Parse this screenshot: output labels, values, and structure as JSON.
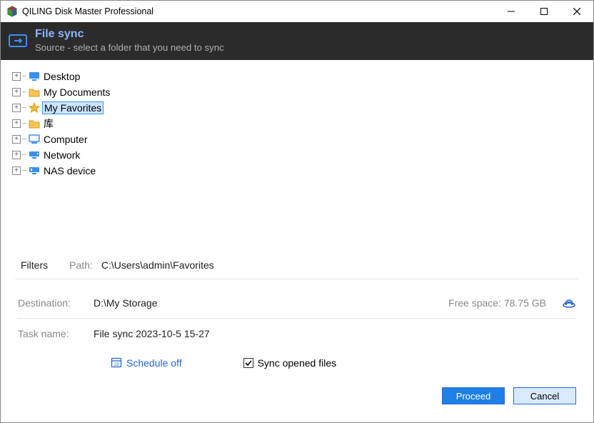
{
  "window": {
    "title": "QILING Disk Master Professional"
  },
  "header": {
    "title": "File sync",
    "subtitle": "Source - select a folder that you need to sync"
  },
  "tree": {
    "items": [
      {
        "label": "Desktop",
        "icon": "desktop",
        "selected": false
      },
      {
        "label": "My Documents",
        "icon": "folder",
        "selected": false
      },
      {
        "label": "My Favorites",
        "icon": "star",
        "selected": true
      },
      {
        "label": "库",
        "icon": "folder",
        "selected": false
      },
      {
        "label": "Computer",
        "icon": "computer",
        "selected": false
      },
      {
        "label": "Network",
        "icon": "network",
        "selected": false
      },
      {
        "label": "NAS device",
        "icon": "nas",
        "selected": false
      }
    ]
  },
  "filters_label": "Filters",
  "path_label": "Path:",
  "path_value": "C:\\Users\\admin\\Favorites",
  "destination": {
    "label": "Destination:",
    "value": "D:\\My Storage",
    "free_space": "Free space: 78.75 GB"
  },
  "task": {
    "label": "Task name:",
    "value": "File sync 2023-10-5 15-27"
  },
  "schedule": {
    "label": "Schedule off"
  },
  "sync_opened": {
    "label": "Sync opened files",
    "checked": true
  },
  "buttons": {
    "proceed": "Proceed",
    "cancel": "Cancel"
  }
}
